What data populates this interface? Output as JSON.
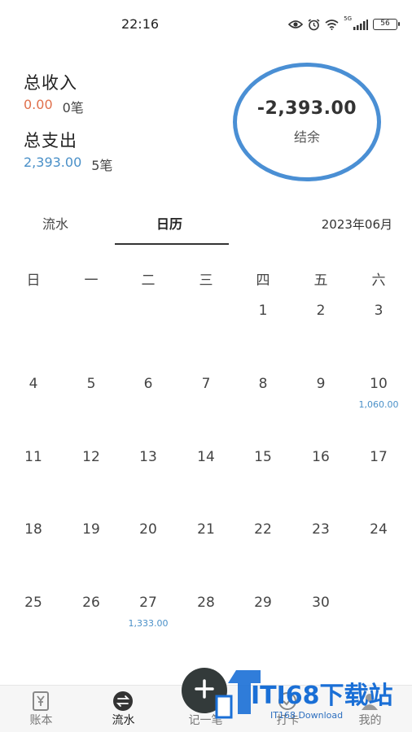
{
  "status_bar": {
    "time": "22:16",
    "network": "5G",
    "battery": "56"
  },
  "summary": {
    "income_label": "总收入",
    "income_amount": "0.00",
    "income_count": "0笔",
    "expense_label": "总支出",
    "expense_amount": "2,393.00",
    "expense_count": "5笔",
    "balance_value": "-2,393.00",
    "balance_label": "结余"
  },
  "tabs": {
    "flow": "流水",
    "calendar": "日历",
    "active": "calendar"
  },
  "month": "2023年06月",
  "calendar": {
    "weekdays": [
      "日",
      "一",
      "二",
      "三",
      "四",
      "五",
      "六"
    ],
    "weeks": [
      [
        "",
        "",
        "",
        "",
        "1",
        "2",
        "3"
      ],
      [
        "4",
        "5",
        "6",
        "7",
        "8",
        "9",
        "10"
      ],
      [
        "11",
        "12",
        "13",
        "14",
        "15",
        "16",
        "17"
      ],
      [
        "18",
        "19",
        "20",
        "21",
        "22",
        "23",
        "24"
      ],
      [
        "25",
        "26",
        "27",
        "28",
        "29",
        "30",
        ""
      ]
    ],
    "amounts": {
      "10": "1,060.00",
      "27": "1,333.00"
    }
  },
  "bottom_nav": {
    "items": [
      {
        "label": "账本",
        "icon": "ledger-icon"
      },
      {
        "label": "流水",
        "icon": "flow-icon"
      },
      {
        "label": "记一笔",
        "icon": "add-icon"
      },
      {
        "label": "打卡",
        "icon": "checkin-icon"
      },
      {
        "label": "我的",
        "icon": "profile-icon"
      }
    ],
    "active_index": 1
  },
  "watermark": {
    "text": "ITI68下载站",
    "sub": "IT168 Download"
  },
  "colors": {
    "income": "#e0704c",
    "expense": "#4a90c8",
    "ring": "#4a8fd4",
    "fab": "#333a3a"
  }
}
